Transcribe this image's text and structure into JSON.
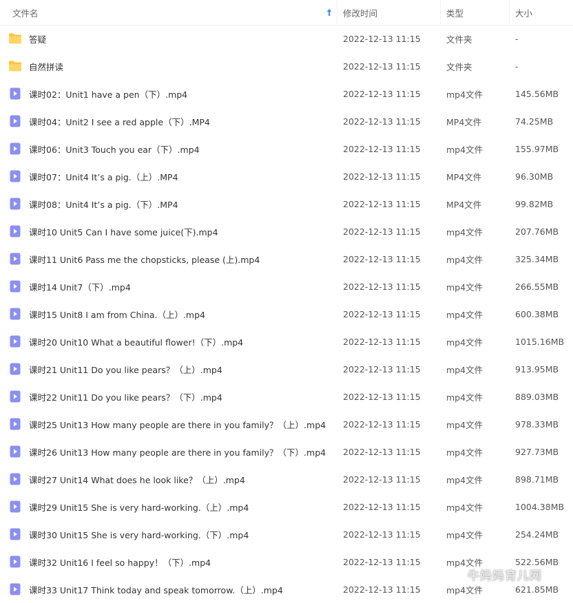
{
  "header": {
    "name_label": "文件名",
    "date_label": "修改时间",
    "type_label": "类型",
    "size_label": "大小"
  },
  "colors": {
    "folder": "#ffc53d",
    "video_icon": "#8b8ff0"
  },
  "files": [
    {
      "icon": "folder-icon",
      "name": "答疑",
      "date": "2022-12-13 11:15",
      "type": "文件夹",
      "size": "-"
    },
    {
      "icon": "folder-icon",
      "name": "自然拼读",
      "date": "2022-12-13 11:15",
      "type": "文件夹",
      "size": "-"
    },
    {
      "icon": "video-file-icon",
      "name": "课时02：Unit1 have a pen（下）.mp4",
      "date": "2022-12-13 11:15",
      "type": "mp4文件",
      "size": "145.56MB"
    },
    {
      "icon": "video-file-icon",
      "name": "课时04：Unit2 I see a red apple（下）.MP4",
      "date": "2022-12-13 11:15",
      "type": "MP4文件",
      "size": "74.25MB"
    },
    {
      "icon": "video-file-icon",
      "name": "课时06：Unit3 Touch you ear（下）.mp4",
      "date": "2022-12-13 11:15",
      "type": "mp4文件",
      "size": "155.97MB"
    },
    {
      "icon": "video-file-icon",
      "name": "课时07：Unit4 It’s a pig.（上）.MP4",
      "date": "2022-12-13 11:15",
      "type": "MP4文件",
      "size": "96.30MB"
    },
    {
      "icon": "video-file-icon",
      "name": "课时08：Unit4 It’s a pig.（下）.MP4",
      "date": "2022-12-13 11:15",
      "type": "MP4文件",
      "size": "99.82MB"
    },
    {
      "icon": "video-file-icon",
      "name": "课时10 Unit5 Can I have some juice(下).mp4",
      "date": "2022-12-13 11:15",
      "type": "mp4文件",
      "size": "207.76MB"
    },
    {
      "icon": "video-file-icon",
      "name": "课时11 Unit6 Pass me the chopsticks, please (上).mp4",
      "date": "2022-12-13 11:15",
      "type": "mp4文件",
      "size": "325.34MB"
    },
    {
      "icon": "video-file-icon",
      "name": "课时14 Unit7（下）.mp4",
      "date": "2022-12-13 11:15",
      "type": "mp4文件",
      "size": "266.55MB"
    },
    {
      "icon": "video-file-icon",
      "name": "课时15 Unit8 I am from China.（上）.mp4",
      "date": "2022-12-13 11:15",
      "type": "mp4文件",
      "size": "600.38MB"
    },
    {
      "icon": "video-file-icon",
      "name": "课时20 Unit10 What a beautiful flower!（下）.mp4",
      "date": "2022-12-13 11:15",
      "type": "mp4文件",
      "size": "1015.16MB"
    },
    {
      "icon": "video-file-icon",
      "name": "课时21 Unit11 Do you like pears？（上）.mp4",
      "date": "2022-12-13 11:15",
      "type": "mp4文件",
      "size": "913.95MB"
    },
    {
      "icon": "video-file-icon",
      "name": "课时22 Unit11 Do you like pears？（下）.mp4",
      "date": "2022-12-13 11:15",
      "type": "mp4文件",
      "size": "889.03MB"
    },
    {
      "icon": "video-file-icon",
      "name": "课时25 Unit13 How many people are there in you family？（上）.mp4",
      "date": "2022-12-13 11:15",
      "type": "mp4文件",
      "size": "978.33MB"
    },
    {
      "icon": "video-file-icon",
      "name": "课时26 Unit13 How many people are there in you family？（下）.mp4",
      "date": "2022-12-13 11:15",
      "type": "mp4文件",
      "size": "927.73MB"
    },
    {
      "icon": "video-file-icon",
      "name": "课时27 Unit14 What does he look like？（上）.mp4",
      "date": "2022-12-13 11:15",
      "type": "mp4文件",
      "size": "898.71MB"
    },
    {
      "icon": "video-file-icon",
      "name": "课时29 Unit15 She is very hard-working.（上）.mp4",
      "date": "2022-12-13 11:15",
      "type": "mp4文件",
      "size": "1004.38MB"
    },
    {
      "icon": "video-file-icon",
      "name": "课时30 Unit15 She is very hard-working.（下）.mp4",
      "date": "2022-12-13 11:15",
      "type": "mp4文件",
      "size": "254.24MB"
    },
    {
      "icon": "video-file-icon",
      "name": "课时32 Unit16 I feel so happy！（下）.mp4",
      "date": "2022-12-13 11:15",
      "type": "mp4文件",
      "size": "522.56MB"
    },
    {
      "icon": "video-file-icon",
      "name": "课时33 Unit17 Think today and speak tomorrow.（上）.mp4",
      "date": "2022-12-13 11:15",
      "type": "mp4文件",
      "size": "621.85MB"
    }
  ],
  "watermark": {
    "text": "牛妈妈育儿网",
    "icon": "wechat-icon"
  }
}
